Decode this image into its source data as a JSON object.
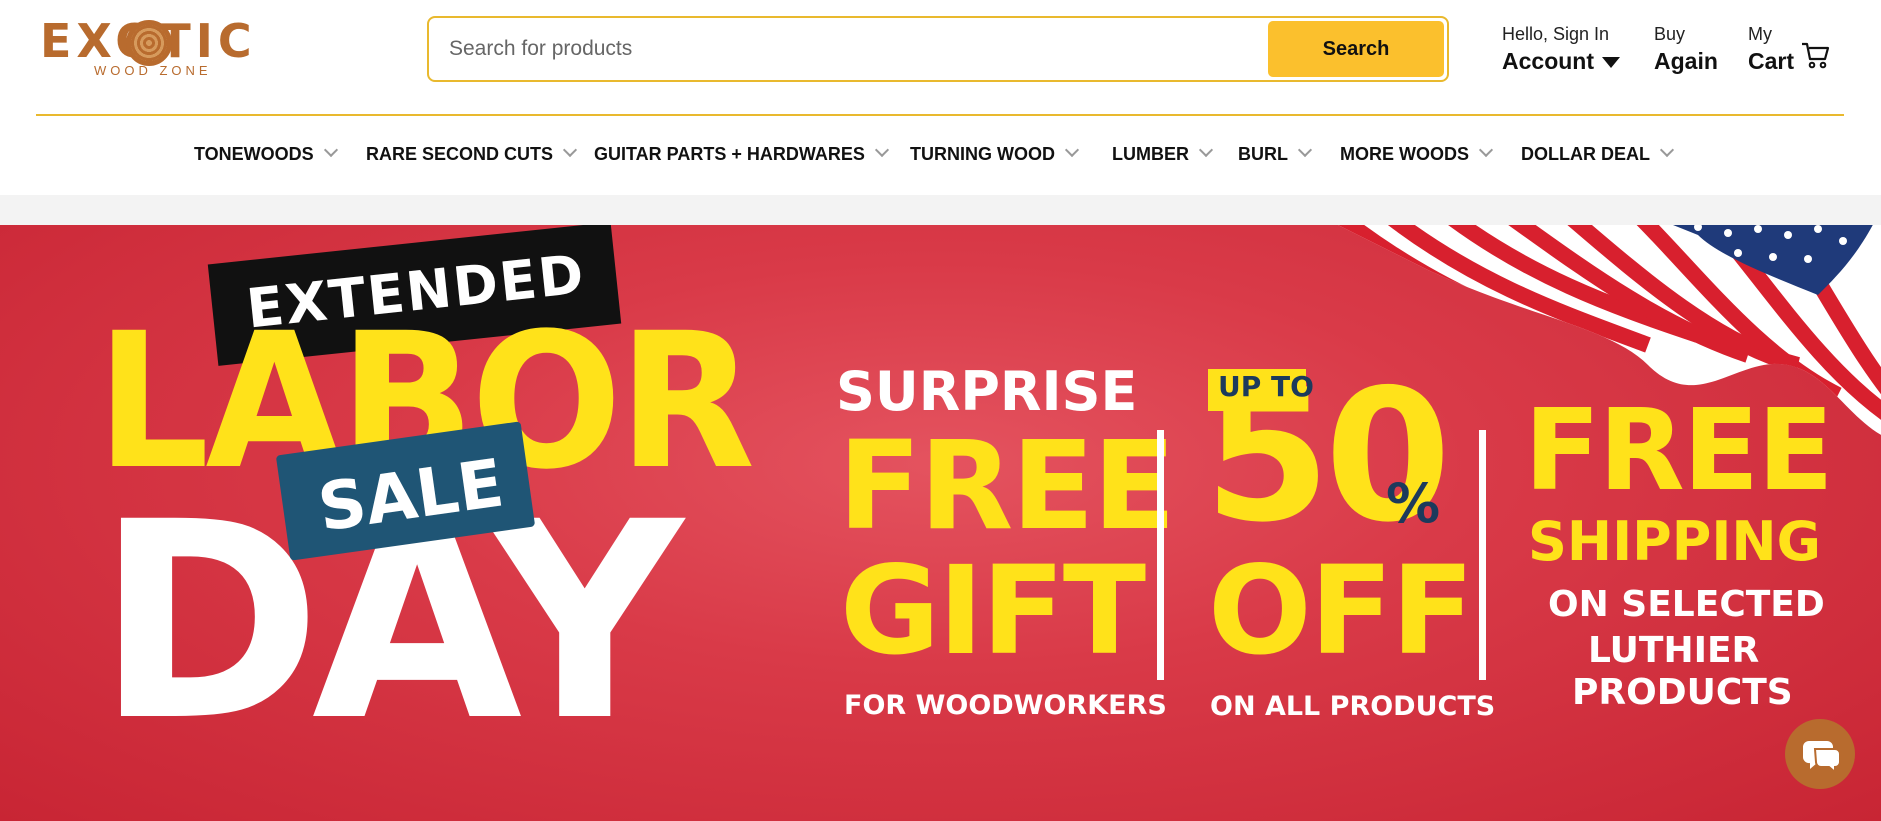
{
  "brand": {
    "logo_main": "EXOTIC",
    "logo_sub": "WOOD ZONE",
    "color": "#b86b2e"
  },
  "search": {
    "placeholder": "Search for products",
    "button_label": "Search",
    "accent": "#fbc02d"
  },
  "header_links": {
    "account_small": "Hello, Sign In",
    "account_big": "Account",
    "again_small": "Buy",
    "again_big": "Again",
    "cart_small": "My",
    "cart_big": "Cart"
  },
  "nav": {
    "items": [
      {
        "label": "TONEWOODS"
      },
      {
        "label": "RARE SECOND CUTS"
      },
      {
        "label": "GUITAR PARTS + HARDWARES"
      },
      {
        "label": "TURNING WOOD"
      },
      {
        "label": "LUMBER"
      },
      {
        "label": "BURL"
      },
      {
        "label": "MORE WOODS"
      },
      {
        "label": "DOLLAR DEAL"
      }
    ]
  },
  "banner": {
    "extended": "EXTENDED",
    "labor": "LABOR",
    "day": "DAY",
    "sale": "SALE",
    "surprise": "SURPRISE",
    "free_gift_1": "FREE",
    "free_gift_2": "GIFT",
    "for_woodworkers": "FOR WOODWORKERS",
    "up_to": "UP TO",
    "fifty": "50",
    "percent": "%",
    "off": "OFF",
    "on_all_products": "ON ALL PRODUCTS",
    "free_shipping_1": "FREE",
    "free_shipping_2": "SHIPPING",
    "on_selected": "ON SELECTED",
    "luthier": "LUTHIER",
    "products": "PRODUCTS",
    "bg_color": "#d93a48",
    "highlight_color": "#ffe21a"
  },
  "icons": {
    "cart": "shopping-cart-icon",
    "chat": "chat-bubble-icon",
    "caret": "caret-down-icon",
    "chevron": "chevron-down-icon",
    "flag": "american-flag-icon"
  }
}
